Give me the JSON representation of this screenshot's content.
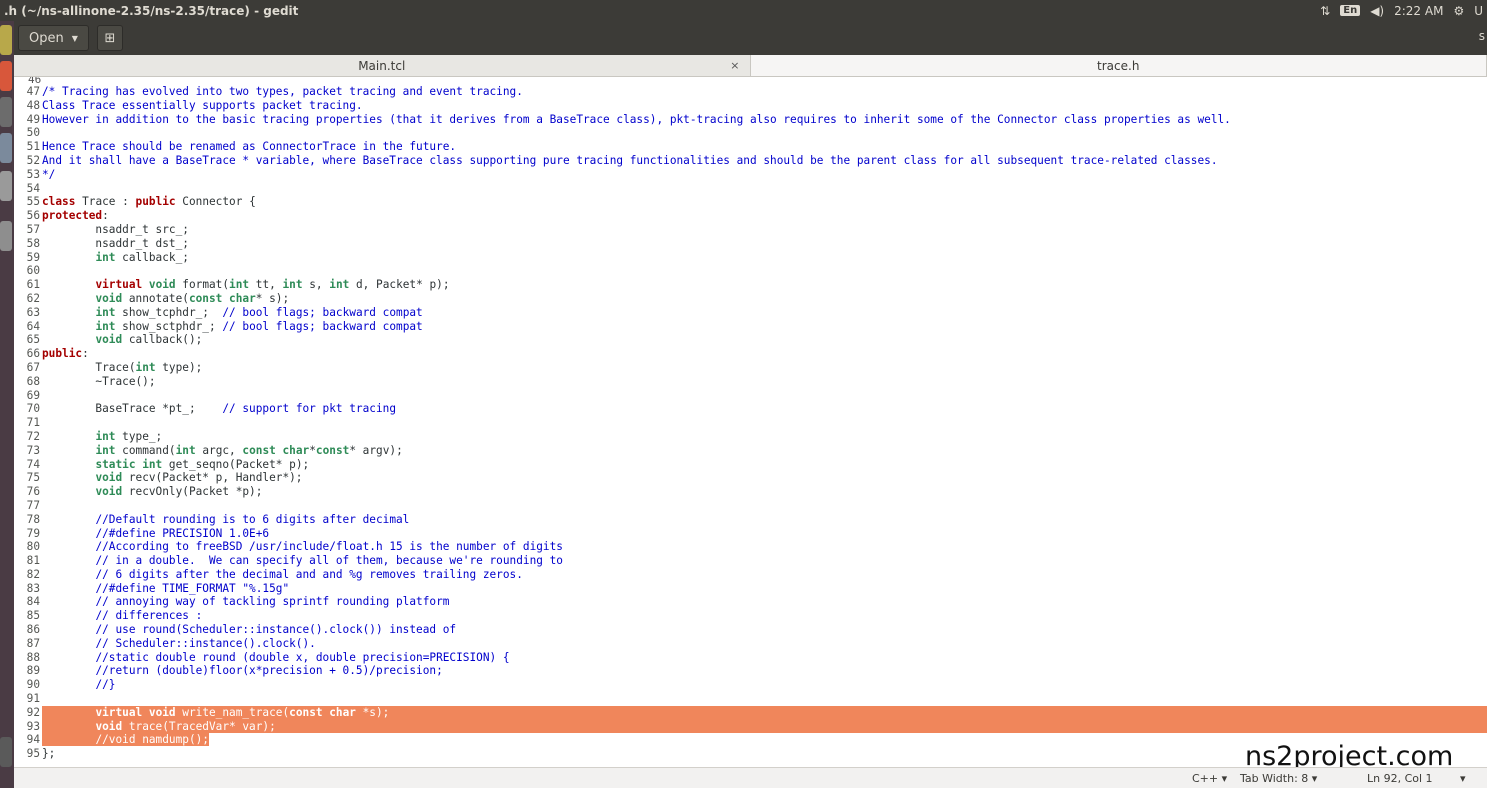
{
  "window": {
    "title": ".h (~/ns-allinone-2.35/ns-2.35/trace) - gedit"
  },
  "panel": {
    "keyboard": "En",
    "volume_icon": "speaker-icon",
    "time": "2:22 AM",
    "user_mark": "U"
  },
  "toolbar": {
    "open_label": "Open",
    "save_icon": "save-icon",
    "right_mark": "s"
  },
  "tabs": [
    {
      "label": "Main.tcl",
      "close": "×"
    },
    {
      "label": "trace.h"
    }
  ],
  "editor": {
    "partial_top": "46",
    "lines": [
      {
        "n": "47",
        "code": [
          [
            "cm",
            "/* Tracing has evolved into two types, packet tracing and event tracing."
          ]
        ]
      },
      {
        "n": "48",
        "code": [
          [
            "cm",
            "Class Trace essentially supports packet tracing."
          ]
        ]
      },
      {
        "n": "49",
        "code": [
          [
            "cm",
            "However in addition to the basic tracing properties (that it derives from a BaseTrace class), pkt-tracing also requires to inherit some of the Connector class properties as well."
          ]
        ]
      },
      {
        "n": "50",
        "code": []
      },
      {
        "n": "51",
        "code": [
          [
            "cm",
            "Hence Trace should be renamed as ConnectorTrace in the future."
          ]
        ]
      },
      {
        "n": "52",
        "code": [
          [
            "cm",
            "And it shall have a BaseTrace * variable, where BaseTrace class supporting pure tracing functionalities and should be the parent class for all subsequent trace-related classes."
          ]
        ]
      },
      {
        "n": "53",
        "code": [
          [
            "cm",
            "*/"
          ]
        ]
      },
      {
        "n": "54",
        "code": []
      },
      {
        "n": "55",
        "code": [
          [
            "kw",
            "class"
          ],
          [
            "",
            " Trace : "
          ],
          [
            "kw",
            "public"
          ],
          [
            "",
            " Connector {"
          ]
        ]
      },
      {
        "n": "56",
        "code": [
          [
            "kw",
            "protected"
          ],
          [
            "",
            ":"
          ]
        ]
      },
      {
        "n": "57",
        "code": [
          [
            "",
            "        nsaddr_t src_;"
          ]
        ]
      },
      {
        "n": "58",
        "code": [
          [
            "",
            "        nsaddr_t dst_;"
          ]
        ]
      },
      {
        "n": "59",
        "code": [
          [
            "",
            "        "
          ],
          [
            "ty",
            "int"
          ],
          [
            "",
            " callback_;"
          ]
        ]
      },
      {
        "n": "60",
        "code": []
      },
      {
        "n": "61",
        "code": [
          [
            "",
            "        "
          ],
          [
            "kw",
            "virtual"
          ],
          [
            "",
            " "
          ],
          [
            "ty",
            "void"
          ],
          [
            "",
            " format("
          ],
          [
            "ty",
            "int"
          ],
          [
            "",
            " tt, "
          ],
          [
            "ty",
            "int"
          ],
          [
            "",
            " s, "
          ],
          [
            "ty",
            "int"
          ],
          [
            "",
            " d, Packet* p);"
          ]
        ]
      },
      {
        "n": "62",
        "code": [
          [
            "",
            "        "
          ],
          [
            "ty",
            "void"
          ],
          [
            "",
            " annotate("
          ],
          [
            "ty",
            "const char"
          ],
          [
            "",
            "* s);"
          ]
        ]
      },
      {
        "n": "63",
        "code": [
          [
            "",
            "        "
          ],
          [
            "ty",
            "int"
          ],
          [
            "",
            " show_tcphdr_;  "
          ],
          [
            "cm",
            "// bool flags; backward compat"
          ]
        ]
      },
      {
        "n": "64",
        "code": [
          [
            "",
            "        "
          ],
          [
            "ty",
            "int"
          ],
          [
            "",
            " show_sctphdr_; "
          ],
          [
            "cm",
            "// bool flags; backward compat"
          ]
        ]
      },
      {
        "n": "65",
        "code": [
          [
            "",
            "        "
          ],
          [
            "ty",
            "void"
          ],
          [
            "",
            " callback();"
          ]
        ]
      },
      {
        "n": "66",
        "code": [
          [
            "kw",
            "public"
          ],
          [
            "",
            ":"
          ]
        ]
      },
      {
        "n": "67",
        "code": [
          [
            "",
            "        Trace("
          ],
          [
            "ty",
            "int"
          ],
          [
            "",
            " type);"
          ]
        ]
      },
      {
        "n": "68",
        "code": [
          [
            "",
            "        ~Trace();"
          ]
        ]
      },
      {
        "n": "69",
        "code": []
      },
      {
        "n": "70",
        "code": [
          [
            "",
            "        BaseTrace *pt_;    "
          ],
          [
            "cm",
            "// support for pkt tracing"
          ]
        ]
      },
      {
        "n": "71",
        "code": []
      },
      {
        "n": "72",
        "code": [
          [
            "",
            "        "
          ],
          [
            "ty",
            "int"
          ],
          [
            "",
            " type_;"
          ]
        ]
      },
      {
        "n": "73",
        "code": [
          [
            "",
            "        "
          ],
          [
            "ty",
            "int"
          ],
          [
            "",
            " command("
          ],
          [
            "ty",
            "int"
          ],
          [
            "",
            " argc, "
          ],
          [
            "ty",
            "const char"
          ],
          [
            "",
            "*"
          ],
          [
            "ty",
            "const"
          ],
          [
            "",
            "* argv);"
          ]
        ]
      },
      {
        "n": "74",
        "code": [
          [
            "",
            "        "
          ],
          [
            "ty",
            "static int"
          ],
          [
            "",
            " get_seqno(Packet* p);"
          ]
        ]
      },
      {
        "n": "75",
        "code": [
          [
            "",
            "        "
          ],
          [
            "ty",
            "void"
          ],
          [
            "",
            " recv(Packet* p, Handler*);"
          ]
        ]
      },
      {
        "n": "76",
        "code": [
          [
            "",
            "        "
          ],
          [
            "ty",
            "void"
          ],
          [
            "",
            " recvOnly(Packet *p);"
          ]
        ]
      },
      {
        "n": "77",
        "code": []
      },
      {
        "n": "78",
        "code": [
          [
            "",
            "        "
          ],
          [
            "cm",
            "//Default rounding is to 6 digits after decimal"
          ]
        ]
      },
      {
        "n": "79",
        "code": [
          [
            "",
            "        "
          ],
          [
            "cm",
            "//#define PRECISION 1.0E+6"
          ]
        ]
      },
      {
        "n": "80",
        "code": [
          [
            "",
            "        "
          ],
          [
            "cm",
            "//According to freeBSD /usr/include/float.h 15 is the number of digits"
          ]
        ]
      },
      {
        "n": "81",
        "code": [
          [
            "",
            "        "
          ],
          [
            "cm",
            "// in a double.  We can specify all of them, because we're rounding to"
          ]
        ]
      },
      {
        "n": "82",
        "code": [
          [
            "",
            "        "
          ],
          [
            "cm",
            "// 6 digits after the decimal and and %g removes trailing zeros."
          ]
        ]
      },
      {
        "n": "83",
        "code": [
          [
            "",
            "        "
          ],
          [
            "cm",
            "//#define TIME_FORMAT \"%.15g\""
          ]
        ]
      },
      {
        "n": "84",
        "code": [
          [
            "",
            "        "
          ],
          [
            "cm",
            "// annoying way of tackling sprintf rounding platform"
          ]
        ]
      },
      {
        "n": "85",
        "code": [
          [
            "",
            "        "
          ],
          [
            "cm",
            "// differences :"
          ]
        ]
      },
      {
        "n": "86",
        "code": [
          [
            "",
            "        "
          ],
          [
            "cm",
            "// use round(Scheduler::instance().clock()) instead of"
          ]
        ]
      },
      {
        "n": "87",
        "code": [
          [
            "",
            "        "
          ],
          [
            "cm",
            "// Scheduler::instance().clock()."
          ]
        ]
      },
      {
        "n": "88",
        "code": [
          [
            "",
            "        "
          ],
          [
            "cm",
            "//static double round (double x, double precision=PRECISION) {"
          ]
        ]
      },
      {
        "n": "89",
        "code": [
          [
            "",
            "        "
          ],
          [
            "cm",
            "//return (double)floor(x*precision + 0.5)/precision;"
          ]
        ]
      },
      {
        "n": "90",
        "code": [
          [
            "",
            "        "
          ],
          [
            "cm",
            "//}"
          ]
        ]
      },
      {
        "n": "91",
        "code": []
      },
      {
        "n": "92",
        "hl": true,
        "code": [
          [
            "",
            "        "
          ],
          [
            "kw",
            "virtual"
          ],
          [
            "",
            " "
          ],
          [
            "ty",
            "void"
          ],
          [
            "",
            " write_nam_trace("
          ],
          [
            "ty",
            "const char"
          ],
          [
            "",
            " *s);"
          ]
        ]
      },
      {
        "n": "93",
        "hl": true,
        "code": [
          [
            "",
            "        "
          ],
          [
            "ty",
            "void"
          ],
          [
            "",
            " trace(TracedVar* var);"
          ]
        ]
      },
      {
        "n": "94",
        "hlpart": true,
        "code": [
          [
            "",
            "        "
          ],
          [
            "cm",
            "//void namdump();"
          ]
        ]
      },
      {
        "n": "95",
        "code": [
          [
            "",
            "};"
          ]
        ]
      }
    ]
  },
  "status": {
    "language": "C++",
    "tab_width": "Tab Width: 8",
    "position": "Ln 92, Col 1"
  },
  "watermark": "ns2project.com",
  "colors": {
    "selection": "#f0865b",
    "keyword": "#a40000",
    "type": "#2e8b57",
    "comment": "#0000cc",
    "panel": "#3c3b37"
  }
}
